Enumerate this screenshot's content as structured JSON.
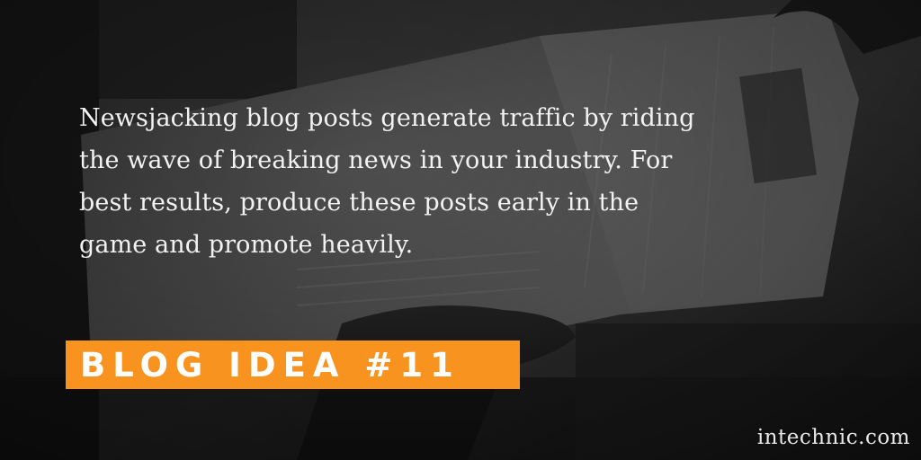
{
  "quote": {
    "text": "Newsjacking blog posts generate traffic by riding\nthe wave of breaking news in your industry. For\nbest results, produce these posts early in the\ngame and promote heavily."
  },
  "badge": {
    "label": "BLOG IDEA #11",
    "color": "#f7931e"
  },
  "footer": {
    "site": "intechnic.com"
  }
}
